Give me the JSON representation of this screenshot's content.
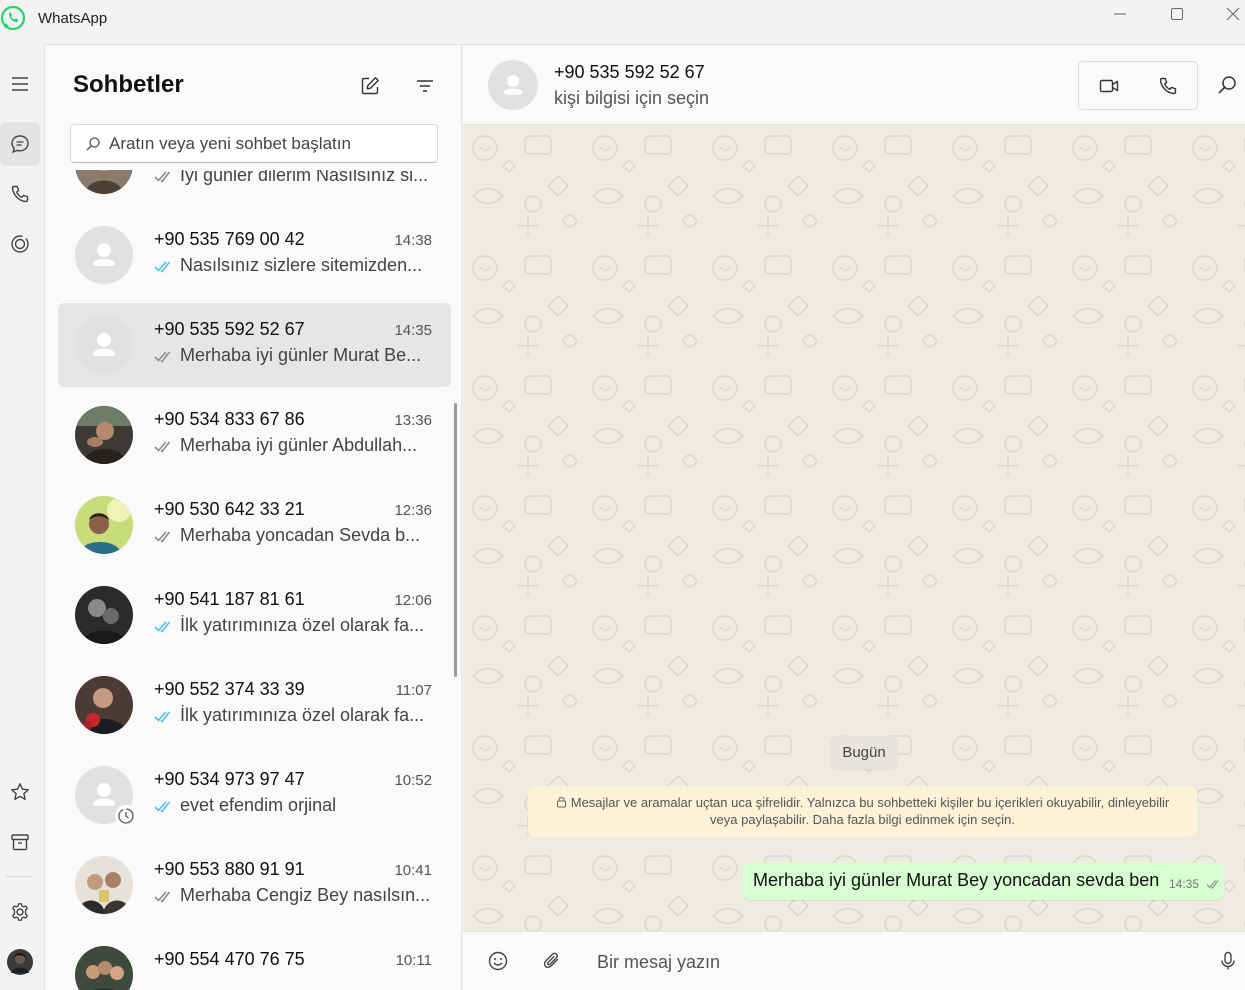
{
  "window": {
    "title": "WhatsApp",
    "controls": [
      "minimize-icon",
      "maximize-icon",
      "close-icon"
    ]
  },
  "rail": {
    "top_items": [
      "menu-icon",
      "chats-icon",
      "calls-icon",
      "status-icon"
    ],
    "bottom_items": [
      "starred-icon",
      "archive-icon",
      "settings-icon",
      "profile-avatar"
    ]
  },
  "chatlist": {
    "title": "Sohbetler",
    "new_chat_icon": "compose-icon",
    "filter_icon": "filter-icon",
    "search": {
      "placeholder": "Aratın veya yeni sohbet başlatın",
      "value": ""
    },
    "rows": [
      {
        "name": "",
        "time": "",
        "message": "İyi günler dilerim Nasılsınız si...",
        "tick": "read-grey",
        "avatar": "photo",
        "selected": false
      },
      {
        "name": "+90 535 769 00 42",
        "time": "14:38",
        "message": "Nasılsınız sizlere sitemizden...",
        "tick": "read-blue",
        "avatar": "default",
        "selected": false
      },
      {
        "name": "+90 535 592 52 67",
        "time": "14:35",
        "message": "Merhaba iyi günler Murat Be...",
        "tick": "read-grey",
        "avatar": "default",
        "selected": true
      },
      {
        "name": "+90 534 833 67 86",
        "time": "13:36",
        "message": "Merhaba iyi günler Abdullah...",
        "tick": "read-grey",
        "avatar": "photo",
        "selected": false
      },
      {
        "name": "+90 530 642 33 21",
        "time": "12:36",
        "message": "Merhaba yoncadan Sevda b...",
        "tick": "read-grey",
        "avatar": "photo",
        "selected": false
      },
      {
        "name": "+90 541 187 81 61",
        "time": "12:06",
        "message": "İlk yatırımınıza özel olarak fa...",
        "tick": "read-blue",
        "avatar": "photo",
        "selected": false
      },
      {
        "name": "+90 552 374 33 39",
        "time": "11:07",
        "message": "İlk yatırımınıza özel olarak fa...",
        "tick": "read-blue",
        "avatar": "photo",
        "selected": false
      },
      {
        "name": "+90 534 973 97 47",
        "time": "10:52",
        "message": "evet efendim orjinal",
        "tick": "read-blue",
        "avatar": "default",
        "status": "disappearing-timer-icon",
        "selected": false
      },
      {
        "name": "+90 553 880 91 91",
        "time": "10:41",
        "message": "Merhaba Cengiz Bey nasılsın...",
        "tick": "read-grey",
        "avatar": "photo",
        "selected": false
      },
      {
        "name": "+90 554 470 76 75",
        "time": "10:11",
        "message": "",
        "tick": "",
        "avatar": "photo",
        "selected": false
      }
    ]
  },
  "conversation": {
    "name": "+90 535 592 52 67",
    "subtitle": "kişi bilgisi için seçin",
    "header_buttons": [
      "video-call-icon",
      "voice-call-icon",
      "search-icon"
    ],
    "day_label": "Bugün",
    "encryption_notice": "Mesajlar ve aramalar uçtan uca şifrelidir. Yalnızca bu sohbetteki kişiler bu içerikleri okuyabilir, dinleyebilir veya paylaşabilir. Daha fazla bilgi edinmek için seçin.",
    "messages": [
      {
        "text": "Merhaba iyi günler Murat Bey yoncadan sevda ben",
        "time": "14:35",
        "outgoing": true,
        "status": "read-grey"
      }
    ],
    "composer": {
      "placeholder": "Bir mesaj yazın",
      "value": ""
    }
  },
  "colors": {
    "brand": "#25d366",
    "read_tick_blue": "#53bdeb",
    "outgoing_bubble": "#d9fdd3",
    "notice_bg": "#fcf2d7",
    "wallpaper": "#efeae2"
  }
}
